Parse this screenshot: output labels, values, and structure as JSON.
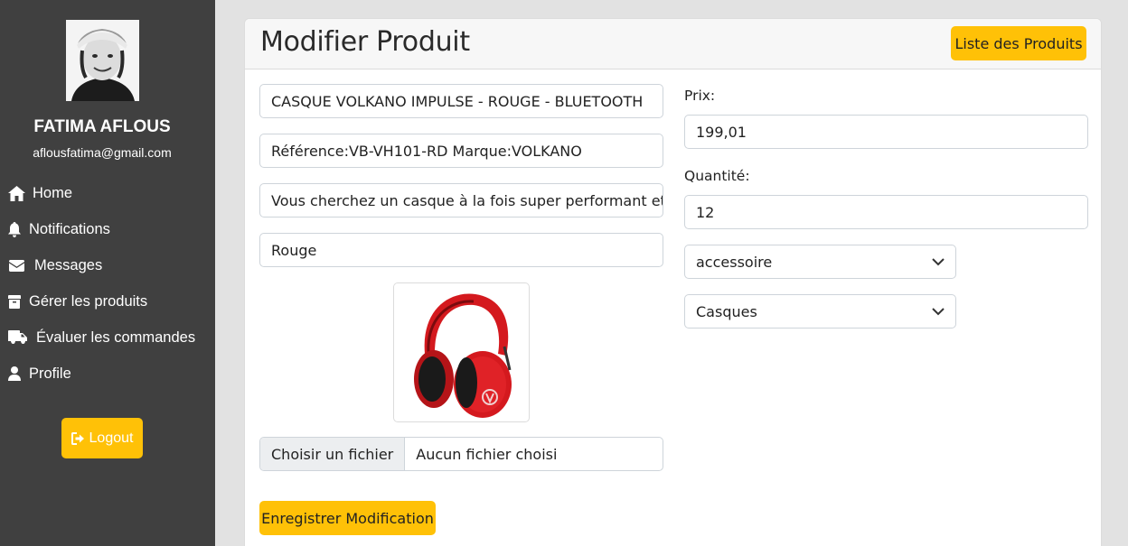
{
  "sidebar": {
    "user_name": "FATIMA AFLOUS",
    "user_email": "aflousfatima@gmail.com",
    "items": [
      {
        "label": "Home",
        "icon": "home-icon"
      },
      {
        "label": "Notifications",
        "icon": "bell-icon"
      },
      {
        "label": "Messages",
        "icon": "envelope-icon"
      },
      {
        "label": "Gérer les produits",
        "icon": "box-icon"
      },
      {
        "label": "Évaluer les commandes",
        "icon": "truck-icon"
      },
      {
        "label": "Profile",
        "icon": "user-icon"
      }
    ],
    "logout_label": "Logout"
  },
  "header": {
    "title": "Modifier Produit",
    "list_button": "Liste des Produits"
  },
  "form": {
    "name_value": "CASQUE VOLKANO IMPULSE - ROUGE - BLUETOOTH",
    "reference_value": "Référence:VB-VH101-RD Marque:VOLKANO",
    "description_value": "Vous cherchez un casque à la fois super performant et su",
    "color_value": "Rouge",
    "price_label": "Prix:",
    "price_value": "199,01",
    "quantity_label": "Quantité:",
    "quantity_value": "12",
    "category_value": "accessoire",
    "subcategory_value": "Casques",
    "file_button": "Choisir un fichier",
    "file_status": "Aucun fichier choisi",
    "save_button": "Enregistrer Modification"
  },
  "colors": {
    "sidebar_bg": "#404040",
    "accent": "#ffc107",
    "product_red": "#d4191e"
  }
}
